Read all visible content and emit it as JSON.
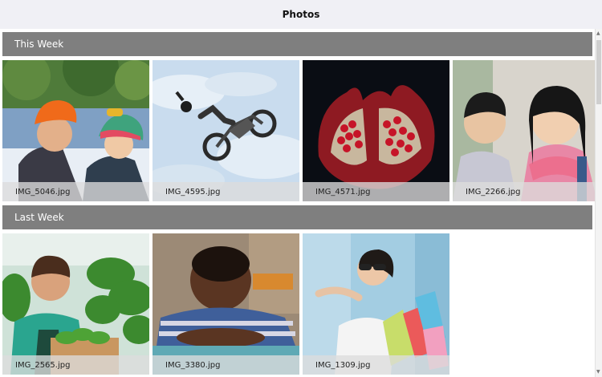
{
  "window": {
    "title": "Photos"
  },
  "sections": [
    {
      "label": "This Week",
      "photos": [
        {
          "caption": "IMG_5046.jpg",
          "icon": "photo-father-son-winter"
        },
        {
          "caption": "IMG_4595.jpg",
          "icon": "photo-motocross-jump"
        },
        {
          "caption": "IMG_4571.jpg",
          "icon": "photo-pomegranate"
        },
        {
          "caption": "IMG_2266.jpg",
          "icon": "photo-children-portrait"
        }
      ]
    },
    {
      "label": "Last Week",
      "photos": [
        {
          "caption": "IMG_2565.jpg",
          "icon": "photo-gardener-vegetables"
        },
        {
          "caption": "IMG_3380.jpg",
          "icon": "photo-boy-smiling"
        },
        {
          "caption": "IMG_1309.jpg",
          "icon": "photo-woman-shopping-bags"
        }
      ]
    }
  ],
  "colors": {
    "section_header": "#7f7f7f",
    "title_bar": "#f0f0f5"
  }
}
